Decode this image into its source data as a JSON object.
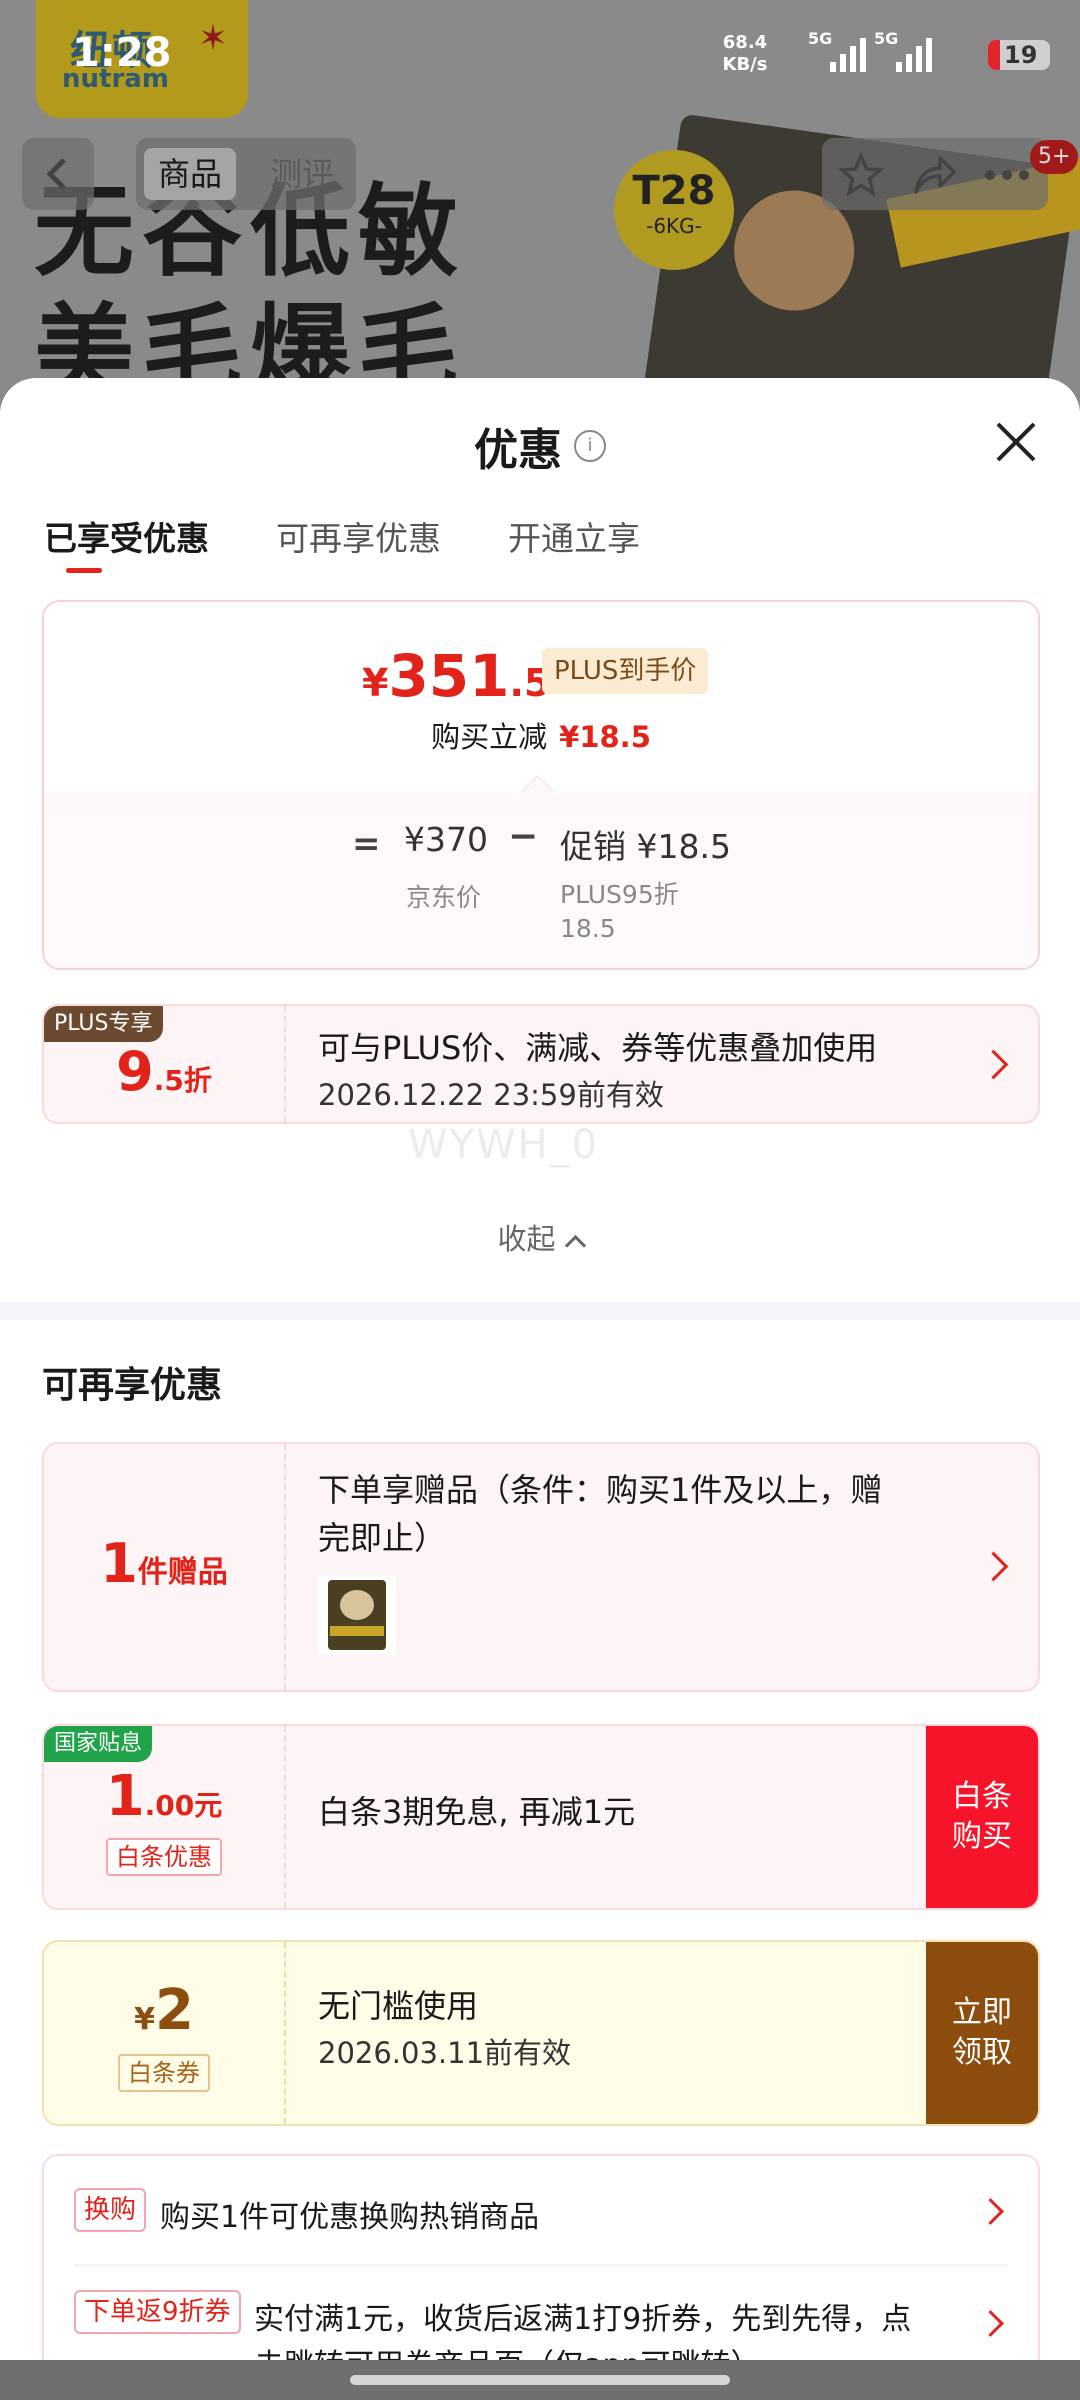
{
  "status_bar": {
    "time": "1:28",
    "net_speed": "68.4 KB/s",
    "signal1": "5G",
    "signal2": "5G",
    "battery": "19"
  },
  "backdrop": {
    "brand": "纽顿",
    "brand_sub": "nutram",
    "hero_line1": "无谷低敏",
    "hero_line2": "美毛爆毛",
    "badge_main": "T28",
    "badge_sub": "-6KG-",
    "tab_product": "商品",
    "tab_review": "测评",
    "notif_count": "5+"
  },
  "sheet": {
    "title": "优惠",
    "info_glyph": "i",
    "tabs": [
      "已享受优惠",
      "可再享优惠",
      "开通立享"
    ],
    "price": {
      "currency": "¥",
      "integer": "351",
      "decimal": ".5",
      "plus_tag": "PLUS到手价",
      "reduce_label": "购买立减",
      "reduce_amount": "¥18.5",
      "eq": "=",
      "orig_price": "¥370",
      "orig_label": "京东价",
      "minus": "−",
      "promo": "促销 ¥18.5",
      "promo_label_1": "PLUS95折",
      "promo_label_2": "18.5"
    },
    "plus_coupon": {
      "tag": "PLUS专享",
      "big": "9",
      "small": ".5折",
      "title": "可与PLUS价、满减、券等优惠叠加使用",
      "validity": "2026.12.22 23:59前有效"
    },
    "watermark": "WYWH_0",
    "collapse_label": "收起",
    "more_section": {
      "title": "可再享优惠",
      "gift": {
        "big": "1",
        "unit": "件赠品",
        "title_line1": "下单享赠品（条件：购买1件及以上，赠",
        "title_line2": "完即止）"
      },
      "baitiao": {
        "corner": "国家贴息",
        "big": "1",
        "small": ".00元",
        "tag": "白条优惠",
        "title": "白条3期免息, 再减1元",
        "btn_line1": "白条",
        "btn_line2": "购买"
      },
      "voucher": {
        "cur": "¥",
        "big": "2",
        "tag": "白条券",
        "title": "无门槛使用",
        "validity": "2026.03.11前有效",
        "btn_line1": "立即",
        "btn_line2": "领取"
      },
      "list": [
        {
          "tag": "换购",
          "text": "购买1件可优惠换购热销商品"
        },
        {
          "tag": "下单返9折券",
          "text": "实付满1元，收货后返满1打9折券，先到先得，点",
          "text2": "击跳转可用券商品页（仅app可跳转）"
        }
      ]
    }
  },
  "colors": {
    "accent": "#e2231a",
    "plus_brown": "#6b4a2f",
    "gov_green": "#21a34a",
    "gold_btn": "#8c4d0f"
  }
}
